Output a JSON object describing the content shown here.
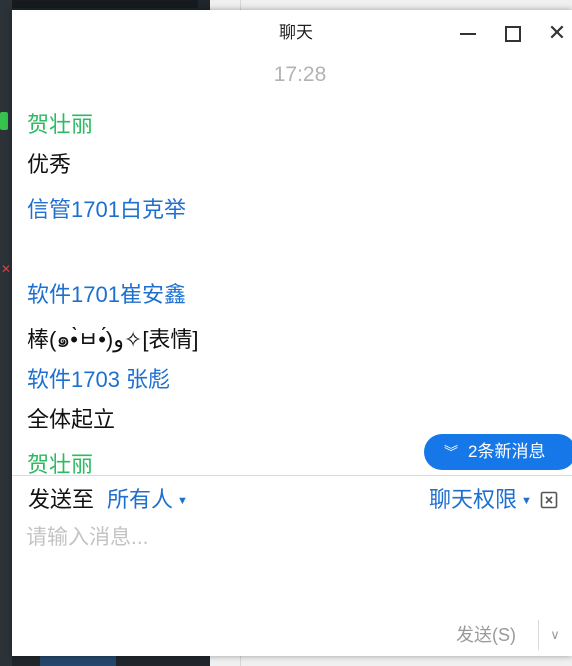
{
  "window": {
    "title": "聊天"
  },
  "messages": {
    "timestamp": "17:28",
    "items": [
      {
        "sender": "贺壮丽",
        "text": "优秀",
        "sender_color": "#2dbb62"
      },
      {
        "sender": "信管1701白克举",
        "text": "",
        "sender_color": "#1d6fd0"
      },
      {
        "sender": "软件1701崔安鑫",
        "text": "棒(๑•̀ㅂ•́)و✧[表情]",
        "sender_color": "#1d6fd0"
      },
      {
        "sender": "软件1703 张彪",
        "text": "全体起立",
        "sender_color": "#1d6fd0"
      },
      {
        "sender": "贺壮丽",
        "text": "",
        "sender_color": "#2dbb62"
      }
    ],
    "new_messages_label": "2条新消息"
  },
  "composer": {
    "send_to_label": "发送至",
    "recipient": "所有人",
    "permission_label": "聊天权限",
    "input_placeholder": "请输入消息...",
    "input_value": "",
    "send_label": "发送(S)"
  },
  "icons": {
    "minimize": "minimize-icon",
    "maximize": "maximize-icon",
    "close": "close-icon",
    "new_messages": "double-chevron-down-icon",
    "recipient_caret": "caret-down-icon",
    "permission_caret": "caret-down-icon",
    "expand": "expand-icon",
    "send_dropdown": "chevron-down-icon"
  },
  "colors": {
    "accent": "#1677e8",
    "link_blue": "#1d6fd0",
    "green_name": "#2dbb62",
    "placeholder": "#c4c4c4"
  }
}
